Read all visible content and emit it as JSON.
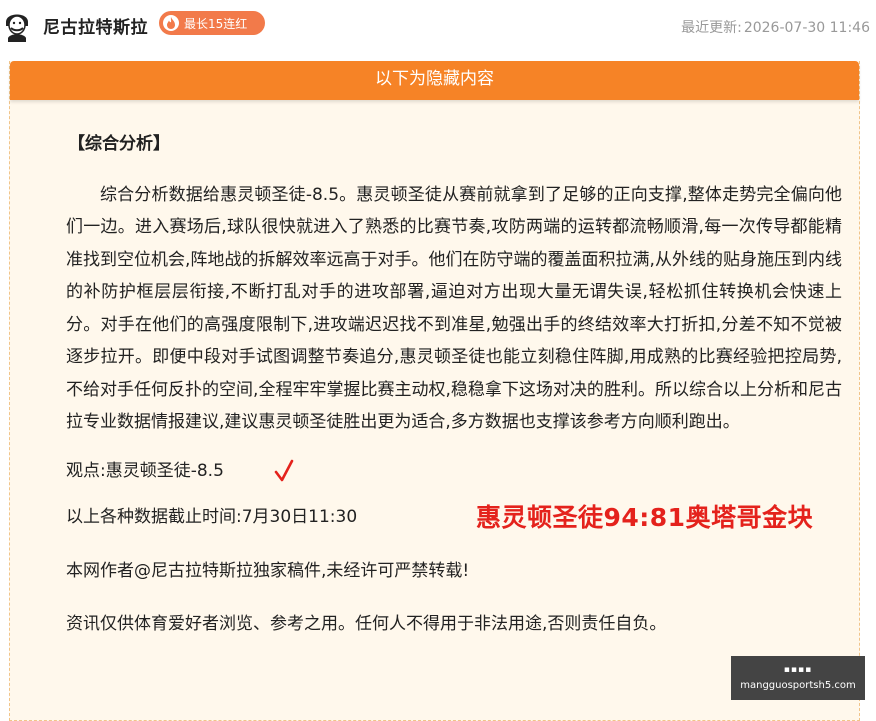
{
  "header": {
    "author_name": "尼古拉特斯拉",
    "streak_badge": "最长15连红",
    "update_label": "最近更新:",
    "update_time": "2026-07-30 11:46"
  },
  "panel": {
    "head_label": "以下为隐藏内容",
    "section_title": "【综合分析】",
    "analysis": "综合分析数据给惠灵顿圣徒-8.5。惠灵顿圣徒从赛前就拿到了足够的正向支撑,整体走势完全偏向他们一边。进入赛场后,球队很快就进入了熟悉的比赛节奏,攻防两端的运转都流畅顺滑,每一次传导都能精准找到空位机会,阵地战的拆解效率远高于对手。他们在防守端的覆盖面积拉满,从外线的贴身施压到内线的补防护框层层衔接,不断打乱对手的进攻部署,逼迫对方出现大量无谓失误,轻松抓住转换机会快速上分。对手在他们的高强度限制下,进攻端迟迟找不到准星,勉强出手的终结效率大打折扣,分差不知不觉被逐步拉开。即便中段对手试图调整节奏追分,惠灵顿圣徒也能立刻稳住阵脚,用成熟的比赛经验把控局势,不给对手任何反扑的空间,全程牢牢掌握比赛主动权,稳稳拿下这场对决的胜利。所以综合以上分析和尼古拉专业数据情报建议,建议惠灵顿圣徒胜出更为适合,多方数据也支撑该参考方向顺利跑出。",
    "opinion": "观点:惠灵顿圣徒-8.5",
    "cutoff": "以上各种数据截止时间:7月30日11:30",
    "copyright": "本网作者@尼古拉特斯拉独家稿件,未经许可严禁转载!",
    "disclaimer": "资讯仅供体育爱好者浏览、参考之用。任何人不得用于非法用途,否则责任自负。",
    "result_stamp": "惠灵顿圣徒94:81奥塔哥金块"
  },
  "watermark": {
    "icon_text": "▪▪▪▪",
    "domain": "mangguosportsh5.com"
  },
  "colors": {
    "accent": "#f68326",
    "badge": "#f27a4a",
    "panel_bg": "#fff8ec",
    "stamp_red": "#e4221c"
  }
}
